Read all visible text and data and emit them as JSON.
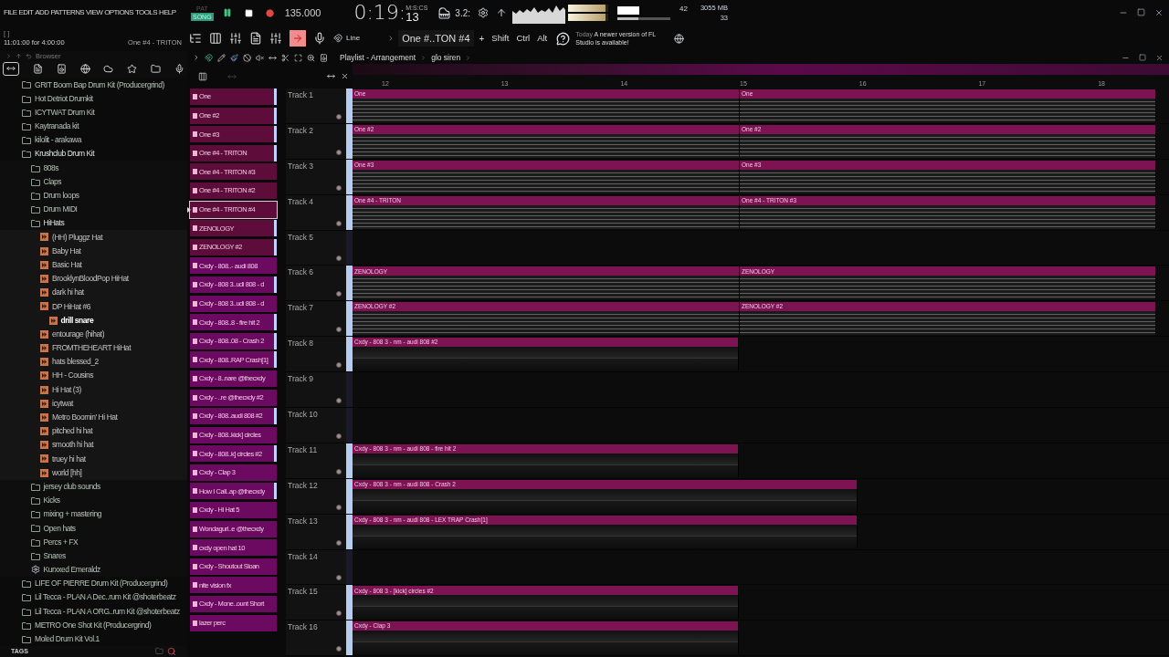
{
  "menu": [
    "FILE",
    "EDIT",
    "ADD",
    "PATTERNS",
    "VIEW",
    "OPTIONS",
    "TOOLS",
    "HELP"
  ],
  "transport": {
    "modes": [
      {
        "label": "PAT",
        "selected": false
      },
      {
        "label": "SONG",
        "selected": true
      }
    ],
    "playing": true,
    "tempo": "135.000",
    "time": "0:19:",
    "time_cs": "13",
    "time_unit": "M:S:CS"
  },
  "step_label": "3.2:",
  "output_meters": [
    {
      "level": 0.92
    },
    {
      "level": 0.92
    }
  ],
  "master_volume": {
    "level": 0.4
  },
  "cpu": "42",
  "memory": "3055 MB",
  "polyphony": "33",
  "hint": {
    "line_1": "[ ]",
    "line_2": "11:01:00 for 4:00:00",
    "pattern": "One #4 - TRITON"
  },
  "snap": "Line",
  "pattern_selector": "One #..TON #4",
  "plus": "+",
  "modifiers": [
    "Shift",
    "Ctrl",
    "Alt"
  ],
  "news": {
    "date": "Today",
    "message": "A newer version of FL Studio is available!"
  },
  "browser": {
    "title": "Browser",
    "footer": "TAGS",
    "tree": [
      {
        "name": "GRIT Boom Bap Drum Kit (Producergrind)",
        "kind": "folder",
        "expanded": false,
        "selected": false
      },
      {
        "name": "Hot Detriot Drumkit",
        "kind": "folder",
        "expanded": false,
        "selected": false
      },
      {
        "name": "ICYTWAT Drum Kit",
        "kind": "folder",
        "expanded": false,
        "selected": false
      },
      {
        "name": "Kaytranada kit",
        "kind": "folder",
        "expanded": false,
        "selected": false
      },
      {
        "name": "kilolit - arakawa",
        "kind": "folder",
        "expanded": false,
        "selected": false
      },
      {
        "name": "Krushclub Drum Kit",
        "kind": "folder",
        "expanded": true,
        "selected": false,
        "children": [
          {
            "name": "808s",
            "kind": "folder",
            "expanded": false,
            "selected": false
          },
          {
            "name": "Claps",
            "kind": "folder",
            "expanded": false,
            "selected": false
          },
          {
            "name": "Drum loops",
            "kind": "folder",
            "expanded": false,
            "selected": false
          },
          {
            "name": "Drum MIDI",
            "kind": "folder",
            "expanded": false,
            "selected": false
          },
          {
            "name": "HiHats",
            "kind": "folder",
            "expanded": true,
            "selected": false,
            "children": [
              {
                "name": "(HH) Pluggz Hat",
                "kind": "file",
                "selected": false
              },
              {
                "name": "Baby Hat",
                "kind": "file",
                "selected": false
              },
              {
                "name": "Basic Hat",
                "kind": "file",
                "selected": false
              },
              {
                "name": "BrooklynBloodPop HiHat",
                "kind": "file",
                "selected": false
              },
              {
                "name": "dark hi hat",
                "kind": "file",
                "selected": false
              },
              {
                "name": "DP HiHat #6",
                "kind": "file",
                "selected": false,
                "children": [
                  {
                    "name": "drill snare",
                    "kind": "file",
                    "selected": true
                  }
                ]
              },
              {
                "name": "entourage (hihat)",
                "kind": "file",
                "selected": false
              },
              {
                "name": "FROMTHEHEART HiHat",
                "kind": "file",
                "selected": false
              },
              {
                "name": "hats blessed_2",
                "kind": "file",
                "selected": false
              },
              {
                "name": "HH - Cousins",
                "kind": "file",
                "selected": false
              },
              {
                "name": "Hi Hat (3)",
                "kind": "file",
                "selected": false
              },
              {
                "name": "icytwat",
                "kind": "file",
                "selected": false
              },
              {
                "name": "Metro Boomin' Hi Hat",
                "kind": "file",
                "selected": false
              },
              {
                "name": "pitched hi hat",
                "kind": "file",
                "selected": false
              },
              {
                "name": "smooth hi hat",
                "kind": "file",
                "selected": false
              },
              {
                "name": "truey hi hat",
                "kind": "file",
                "selected": false
              },
              {
                "name": "world [hh]",
                "kind": "file",
                "selected": false
              }
            ]
          },
          {
            "name": "jersey club sounds",
            "kind": "folder",
            "expanded": false,
            "selected": false
          },
          {
            "name": "Kicks",
            "kind": "folder",
            "expanded": false,
            "selected": false
          },
          {
            "name": "mixing + mastering",
            "kind": "folder",
            "expanded": false,
            "selected": false
          },
          {
            "name": "Open hats",
            "kind": "folder",
            "expanded": false,
            "selected": false
          },
          {
            "name": "Percs + FX",
            "kind": "folder",
            "expanded": false,
            "selected": false
          },
          {
            "name": "Snares",
            "kind": "folder",
            "expanded": false,
            "selected": false
          },
          {
            "name": "Kurxxed Emeraldz",
            "kind": "plugin",
            "selected": false
          }
        ]
      },
      {
        "name": "LIFE OF PIERRE Drum Kit (Producergrind)",
        "kind": "folder",
        "expanded": false,
        "selected": false
      },
      {
        "name": "Lil Tecca - PLAN A Dec..rum Kit @shoterbeatz",
        "kind": "folder",
        "expanded": false,
        "selected": false
      },
      {
        "name": "Lil Tecca - PLAN A ORG..rum Kit @shoterbeatz",
        "kind": "folder",
        "expanded": false,
        "selected": false
      },
      {
        "name": "METRO One Shot Kit (Producergrind)",
        "kind": "folder",
        "expanded": false,
        "selected": false
      },
      {
        "name": "Moled Drum Kit Vol.1",
        "kind": "folder",
        "expanded": false,
        "selected": false
      }
    ]
  },
  "playlist": {
    "title": "Playlist - Arrangement",
    "path": "glo siren",
    "ruler": [
      "12",
      "13",
      "14",
      "15",
      "16",
      "17",
      "18"
    ],
    "patterns": [
      {
        "name": "One",
        "color": "#5e0c3a",
        "in_use": true,
        "selected": false
      },
      {
        "name": "One #2",
        "color": "#5e0c3a",
        "in_use": true,
        "selected": false
      },
      {
        "name": "One #3",
        "color": "#5e0c3a",
        "in_use": true,
        "selected": false
      },
      {
        "name": "One #4 - TRITON",
        "color": "#5e0c3a",
        "in_use": true,
        "selected": false
      },
      {
        "name": "One #4 - TRITON #3",
        "color": "#5e0c3a",
        "in_use": false,
        "selected": false
      },
      {
        "name": "One #4 - TRITON #2",
        "color": "#5e0c3a",
        "in_use": false,
        "selected": false
      },
      {
        "name": "One #4 - TRITON #4",
        "color": "#5e0c3a",
        "in_use": false,
        "selected": true
      },
      {
        "name": "ZENOLOGY",
        "color": "#5e0c3a",
        "in_use": true,
        "selected": false
      },
      {
        "name": "ZENOLOGY #2",
        "color": "#5e0c3a",
        "in_use": true,
        "selected": false
      },
      {
        "name": "Cxdy - 808..- audi 808",
        "color": "#6c0a62",
        "in_use": false,
        "selected": false
      },
      {
        "name": "Cxdy - 808 3..udi 808 - d",
        "color": "#6c0a62",
        "in_use": true,
        "selected": false
      },
      {
        "name": "Cxdy - 808 3..udi 808 - d",
        "color": "#6c0a62",
        "in_use": false,
        "selected": false
      },
      {
        "name": "Cxdy - 808..8 - fire hit 2",
        "color": "#6c0a62",
        "in_use": true,
        "selected": false
      },
      {
        "name": "Cxdy - 808..08 - Crash 2",
        "color": "#6c0a62",
        "in_use": true,
        "selected": false
      },
      {
        "name": "Cxdy - 808..RAP Crash[1]",
        "color": "#6c0a62",
        "in_use": true,
        "selected": false
      },
      {
        "name": "Cxdy - 8..nare @thecxdy",
        "color": "#6c0a62",
        "in_use": false,
        "selected": false
      },
      {
        "name": "Cxdy - ..re @thecxdy #2",
        "color": "#6c0a62",
        "in_use": false,
        "selected": false
      },
      {
        "name": "Cxdy - 808..audi 808 #2",
        "color": "#6c0a62",
        "in_use": true,
        "selected": false
      },
      {
        "name": "Cxdy - 808..kick] circles",
        "color": "#6c0a62",
        "in_use": false,
        "selected": false
      },
      {
        "name": "Cxdy - 808..k] circles #2",
        "color": "#6c0a62",
        "in_use": true,
        "selected": false
      },
      {
        "name": "Cxdy - Clap 3",
        "color": "#6c0a62",
        "in_use": false,
        "selected": false
      },
      {
        "name": "How I Call..ap @thecxdy",
        "color": "#6c0a62",
        "in_use": true,
        "selected": false
      },
      {
        "name": "Cxdy - Hi Hat 5",
        "color": "#6c0a62",
        "in_use": false,
        "selected": false
      },
      {
        "name": "Wondagurl..e @thecxdy",
        "color": "#6c0a62",
        "in_use": false,
        "selected": false
      },
      {
        "name": "cxdy open hat 10",
        "color": "#6c0a62",
        "in_use": false,
        "selected": false
      },
      {
        "name": "Cxdy - Shoutout Sloan",
        "color": "#6c0a62",
        "in_use": false,
        "selected": false
      },
      {
        "name": "nite vision fx",
        "color": "#6c0a62",
        "in_use": false,
        "selected": false
      },
      {
        "name": "Cxdy - Mone..ount Short",
        "color": "#6c0a62",
        "in_use": false,
        "selected": false
      },
      {
        "name": "lazer perc",
        "color": "#6c0a62",
        "in_use": false,
        "selected": false
      }
    ],
    "tracks": [
      {
        "name": "Track 1",
        "kind": "split",
        "clips": [
          {
            "name": "One"
          },
          {
            "name": "One"
          }
        ]
      },
      {
        "name": "Track 2",
        "kind": "split",
        "clips": [
          {
            "name": "One #2"
          },
          {
            "name": "One #2"
          }
        ]
      },
      {
        "name": "Track 3",
        "kind": "split",
        "clips": [
          {
            "name": "One #3"
          },
          {
            "name": "One #3"
          }
        ]
      },
      {
        "name": "Track 4",
        "kind": "split",
        "clips": [
          {
            "name": "One #4 - TRITON"
          },
          {
            "name": "One #4 - TRITON #3"
          }
        ]
      },
      {
        "name": "Track 5",
        "kind": "empty"
      },
      {
        "name": "Track 6",
        "kind": "split",
        "clips": [
          {
            "name": "ZENOLOGY"
          },
          {
            "name": "ZENOLOGY"
          }
        ]
      },
      {
        "name": "Track 7",
        "kind": "split",
        "clips": [
          {
            "name": "ZENOLOGY #2"
          },
          {
            "name": "ZENOLOGY #2"
          }
        ]
      },
      {
        "name": "Track 8",
        "kind": "short",
        "clips": [
          {
            "name": "Cxdy - 808 3 - nm - audi 808 #2"
          }
        ]
      },
      {
        "name": "Track 9",
        "kind": "empty"
      },
      {
        "name": "Track 10",
        "kind": "empty"
      },
      {
        "name": "Track 11",
        "kind": "short",
        "clips": [
          {
            "name": "Cxdy - 808 3 - nm - audi 808 - fire hit 2"
          }
        ]
      },
      {
        "name": "Track 12",
        "kind": "medium",
        "clips": [
          {
            "name": "Cxdy - 808 3 - nm - audi 808 - Crash 2"
          }
        ]
      },
      {
        "name": "Track 13",
        "kind": "medium",
        "clips": [
          {
            "name": "Cxdy - 808 3 - nm - audi 808 - LEX TRAP Crash[1]"
          }
        ]
      },
      {
        "name": "Track 14",
        "kind": "empty"
      },
      {
        "name": "Track 15",
        "kind": "short",
        "clips": [
          {
            "name": "Cxdy - 808 3 - [kick] circles #2"
          }
        ]
      },
      {
        "name": "Track 16",
        "kind": "short",
        "clips": [
          {
            "name": "Cxdy - Clap 3"
          }
        ]
      }
    ]
  }
}
